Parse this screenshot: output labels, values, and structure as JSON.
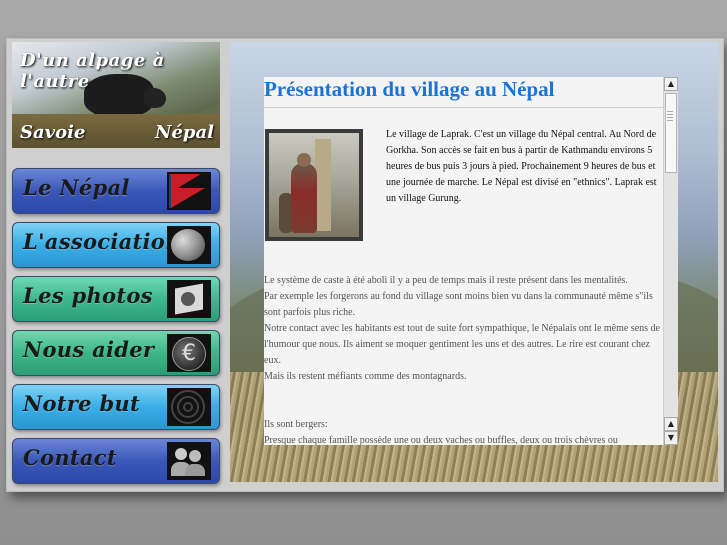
{
  "banner": {
    "title": "D'un alpage à l'autre",
    "left": "Savoie",
    "right": "Népal"
  },
  "nav": {
    "items": [
      {
        "label": "Le Népal",
        "icon": "nepal-flag-icon",
        "color": "#3b58b8"
      },
      {
        "label": "L'association",
        "icon": "globe-icon",
        "color": "#3aaee6"
      },
      {
        "label": "Les photos",
        "icon": "camera-icon",
        "color": "#3fb88e"
      },
      {
        "label": "Nous aider",
        "icon": "euro-icon",
        "color": "#3db68a"
      },
      {
        "label": "Notre but",
        "icon": "target-icon",
        "color": "#3aaee6"
      },
      {
        "label": "Contact",
        "icon": "users-icon",
        "color": "#3b58b8"
      }
    ]
  },
  "content": {
    "title": "Présentation du village au Népal",
    "intro": "Le village de Laprak. C'est un village du Népal central. Au Nord de Gorkha. Son accès se fait en bus à partir de Kathmandu environs 5 heures de bus puis 3 jours à pied. Prochainement 9 heures de bus et une journée de marche. Le Népal est divisé en \"ethnics\". Laprak est un village Gurung.",
    "body": [
      "Le système de caste à été aboli il y a peu de temps mais il reste présent dans les mentalités.",
      "Par exemple les forgerons au fond du village sont moins bien vu dans la communauté même s\"ils sont parfois plus riche.",
      "Notre contact avec les habitants est tout de suite fort sympathique, le Népalais ont le même sens de l'humour que nous. Ils aiment se moquer gentiment les uns et des autres. Le rire est courant chez eux.",
      "Mais ils restent méfiants comme des montagnards."
    ],
    "body2": [
      "Ils sont bergers:",
      "Presque chaque famille possède une ou deux vaches ou buffles, deux ou trois chèvres ou"
    ]
  },
  "colors": {
    "title": "#1a73d6",
    "panel": "#f4f4f4"
  }
}
